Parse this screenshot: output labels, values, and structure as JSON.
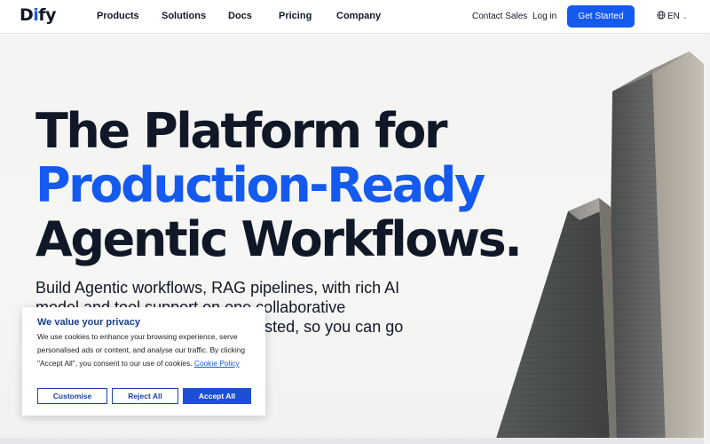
{
  "logo": {
    "text_a": "D",
    "text_b": "i",
    "text_c": "fy"
  },
  "nav": {
    "items": [
      {
        "label": "Products"
      },
      {
        "label": "Solutions"
      },
      {
        "label": "Docs"
      },
      {
        "label": "Pricing"
      },
      {
        "label": "Company"
      }
    ],
    "contact_sales": "Contact Sales",
    "log_in": "Log in",
    "get_started": "Get Started",
    "language": "EN"
  },
  "hero": {
    "line1": "The Platform for",
    "line2": "Production-Ready",
    "line3": "Agentic Workflows.",
    "subtext": "Build Agentic workflows, RAG pipelines, with rich AI model and tool support on one collaborative platform, cloud-based, or self-hosted, so you can go from idea to production without"
  },
  "cookie": {
    "title": "We value your privacy",
    "body": "We use cookies to enhance your browsing experience, serve personalised ads or content, and analyse our traffic. By clicking \"Accept All\", you consent to our use of cookies.",
    "policy_link": "Cookie Policy",
    "customise": "Customise",
    "reject_all": "Reject All",
    "accept_all": "Accept All"
  },
  "colors": {
    "brand_blue": "#155aef",
    "cookie_button_blue": "#1d4ed8",
    "text_dark": "#101828"
  },
  "icons": {
    "language": "globe-icon",
    "language_chevron": "chevron-down-icon"
  }
}
